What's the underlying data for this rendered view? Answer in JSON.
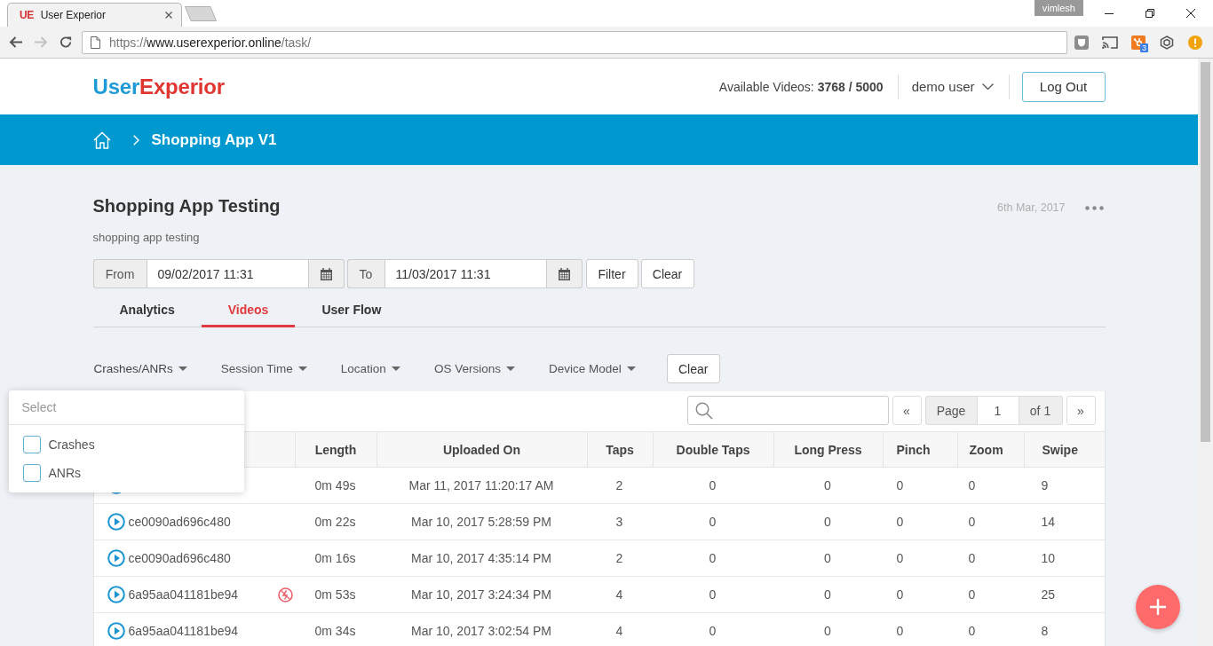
{
  "browser": {
    "tab": {
      "favicon": "UE",
      "title": "User Experior"
    },
    "profile": "vimlesh",
    "forward": {
      "disabled": true
    },
    "url": {
      "scheme": "https://",
      "host": "www.userexperior.online",
      "path": "/task/"
    },
    "extension_badge": "3"
  },
  "header": {
    "logo": {
      "first": "User",
      "second": "Experior"
    },
    "quota": "Available Videos: **3768 / 5000**",
    "user": "demo user",
    "logout": "Log Out"
  },
  "breadcrumb": {
    "current": "Shopping App V1"
  },
  "task": {
    "title": "Shopping App Testing",
    "date": "6th Mar, 2017",
    "description": "shopping app testing"
  },
  "date_filter": {
    "from_label": "From",
    "from_value": "09/02/2017 11:31",
    "to_label": "To",
    "to_value": "11/03/2017 11:31",
    "buttons": [
      "Filter",
      "Clear"
    ]
  },
  "tabs": [
    {
      "label": "Analytics",
      "selected": false
    },
    {
      "label": "Videos",
      "selected": true
    },
    {
      "label": "User Flow",
      "selected": false
    }
  ],
  "filters": [
    {
      "label": "Crashes/ANRs",
      "expanded": true,
      "placeholder": "Select",
      "options": [
        {
          "label": "Crashes",
          "checked": false
        },
        {
          "label": "ANRs",
          "checked": false
        }
      ]
    },
    {
      "label": "Session Time",
      "expanded": false
    },
    {
      "label": "Location",
      "expanded": false
    },
    {
      "label": "OS Versions",
      "expanded": false
    },
    {
      "label": "Device Model",
      "expanded": false
    }
  ],
  "filters_clear": "Clear",
  "pagination": {
    "first": "«",
    "page_label": "Page",
    "page": "1",
    "total": "of 1",
    "last": "»"
  },
  "table": {
    "columns": [
      "Length",
      "Uploaded On",
      "Taps",
      "Double Taps",
      "Long Press",
      "Pinch",
      "Zoom",
      "Swipe"
    ],
    "rows": [
      {
        "crashed": false,
        "cells": [
          "0m 49s",
          "Mar 11, 2017 11:20:17 AM",
          "2",
          "0",
          "0",
          "0",
          "0",
          "9"
        ]
      },
      {
        "id": "ce0090ad696c480",
        "crashed": false,
        "cells": [
          "0m 22s",
          "Mar 10, 2017 5:28:59 PM",
          "3",
          "0",
          "0",
          "0",
          "0",
          "14"
        ]
      },
      {
        "id": "ce0090ad696c480",
        "crashed": false,
        "cells": [
          "0m 16s",
          "Mar 10, 2017 4:35:14 PM",
          "2",
          "0",
          "0",
          "0",
          "0",
          "10"
        ]
      },
      {
        "id": "6a95aa041181be94",
        "crashed": true,
        "cells": [
          "0m 53s",
          "Mar 10, 2017 3:24:34 PM",
          "4",
          "0",
          "0",
          "0",
          "0",
          "25"
        ]
      },
      {
        "id": "6a95aa041181be94",
        "crashed": false,
        "cells": [
          "0m 34s",
          "Mar 10, 2017 3:02:54 PM",
          "4",
          "0",
          "0",
          "0",
          "0",
          "8"
        ]
      }
    ]
  }
}
